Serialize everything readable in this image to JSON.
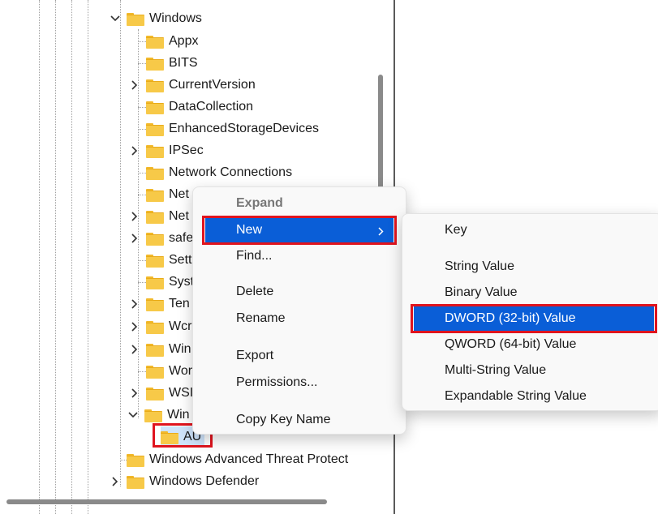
{
  "tree": {
    "items": [
      {
        "label": "Windows",
        "expanded": true
      },
      {
        "label": "Appx"
      },
      {
        "label": "BITS"
      },
      {
        "label": "CurrentVersion"
      },
      {
        "label": "DataCollection"
      },
      {
        "label": "EnhancedStorageDevices"
      },
      {
        "label": "IPSec"
      },
      {
        "label": "Network Connections"
      },
      {
        "label": "Net"
      },
      {
        "label": "Net"
      },
      {
        "label": "safe"
      },
      {
        "label": "Sett"
      },
      {
        "label": "Syst"
      },
      {
        "label": "Ten"
      },
      {
        "label": "Wcr"
      },
      {
        "label": "Win"
      },
      {
        "label": "Wor"
      },
      {
        "label": "WSI"
      },
      {
        "label": "Win",
        "expanded": true
      },
      {
        "label": "AU",
        "selected": true
      },
      {
        "label": "Windows Advanced Threat Protect"
      },
      {
        "label": "Windows Defender"
      }
    ]
  },
  "context_menu": {
    "expand": "Expand",
    "new": "New",
    "find": "Find...",
    "delete": "Delete",
    "rename": "Rename",
    "export": "Export",
    "permissions": "Permissions...",
    "copy_key_name": "Copy Key Name"
  },
  "submenu": {
    "key": "Key",
    "string_value": "String Value",
    "binary_value": "Binary Value",
    "dword_value": "DWORD (32-bit) Value",
    "qword_value": "QWORD (64-bit) Value",
    "multi_string_value": "Multi-String Value",
    "expandable_string_value": "Expandable String Value"
  },
  "colors": {
    "highlight": "#0a5ed7",
    "annotation_red": "#e0141e",
    "folder": "#f7c948"
  },
  "icons": {
    "folder": "folder-icon",
    "expand": "chevron-right-icon",
    "collapse": "chevron-down-icon",
    "submenu_arrow": "chevron-right-icon"
  }
}
